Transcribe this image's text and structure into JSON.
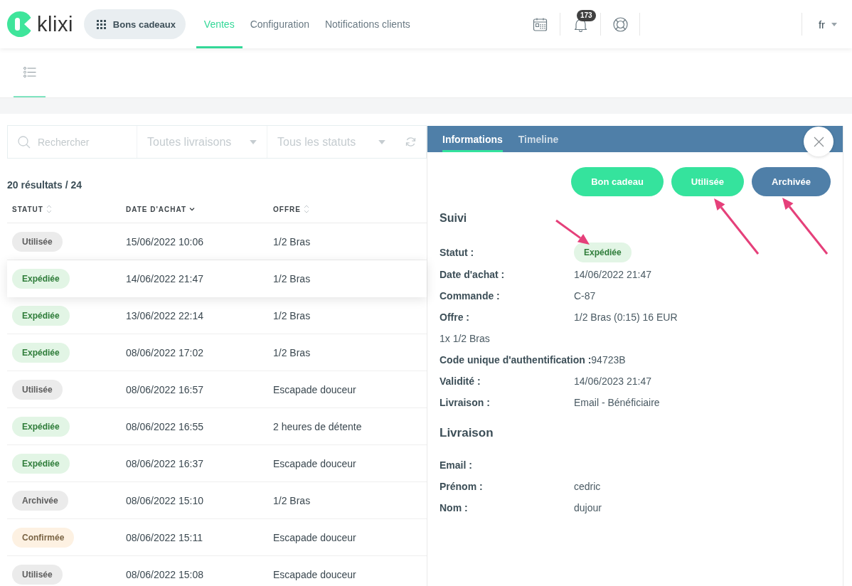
{
  "navbar": {
    "logo": "klixi",
    "app_button": "Bons cadeaux",
    "tabs": [
      {
        "label": "Ventes",
        "selected": true
      },
      {
        "label": "Configuration",
        "selected": false
      },
      {
        "label": "Notifications clients",
        "selected": false
      }
    ],
    "notifications_count": "173",
    "language": "fr"
  },
  "toolbar": {
    "views": [
      {
        "selected": true
      }
    ]
  },
  "filters": {
    "search": {
      "placeholder": "Rechercher"
    },
    "selects": [
      {
        "placeholder": "Toutes livraisons"
      },
      {
        "placeholder": "Tous les statuts"
      }
    ]
  },
  "results": "20 résultats / 24",
  "table": {
    "columns": [
      {
        "label": "STATUT",
        "sorted": false
      },
      {
        "label": "DATE D'ACHAT",
        "sorted": true
      },
      {
        "label": "OFFRE",
        "sorted": false
      }
    ],
    "rows": [
      {
        "status": {
          "label": "Utilisée",
          "kind": "neutral"
        },
        "date": "15/06/2022 10:06",
        "offer": "1/2 Bras",
        "selected": false
      },
      {
        "status": {
          "label": "Expédiée",
          "kind": "success"
        },
        "date": "14/06/2022 21:47",
        "offer": "1/2 Bras",
        "selected": true
      },
      {
        "status": {
          "label": "Expédiée",
          "kind": "success"
        },
        "date": "13/06/2022 22:14",
        "offer": "1/2 Bras",
        "selected": false
      },
      {
        "status": {
          "label": "Expédiée",
          "kind": "success"
        },
        "date": "08/06/2022 17:02",
        "offer": "1/2 Bras",
        "selected": false
      },
      {
        "status": {
          "label": "Utilisée",
          "kind": "neutral"
        },
        "date": "08/06/2022 16:57",
        "offer": "Escapade douceur",
        "selected": false
      },
      {
        "status": {
          "label": "Expédiée",
          "kind": "success"
        },
        "date": "08/06/2022 16:55",
        "offer": "2 heures de détente",
        "selected": false
      },
      {
        "status": {
          "label": "Expédiée",
          "kind": "success"
        },
        "date": "08/06/2022 16:37",
        "offer": "Escapade douceur",
        "selected": false
      },
      {
        "status": {
          "label": "Archivée",
          "kind": "neutral"
        },
        "date": "08/06/2022 15:10",
        "offer": "1/2 Bras",
        "selected": false
      },
      {
        "status": {
          "label": "Confirmée",
          "kind": "warning"
        },
        "date": "08/06/2022 15:11",
        "offer": "Escapade douceur",
        "selected": false
      },
      {
        "status": {
          "label": "Utilisée",
          "kind": "neutral"
        },
        "date": "08/06/2022 15:08",
        "offer": "Escapade douceur",
        "selected": false
      }
    ]
  },
  "detail": {
    "tabs": [
      {
        "label": "Informations",
        "selected": true
      },
      {
        "label": "Timeline",
        "selected": false
      }
    ],
    "actions": [
      {
        "label": "Bon cadeau",
        "kind": "primary"
      },
      {
        "label": "Utilisée",
        "kind": "primary"
      },
      {
        "label": "Archivée",
        "kind": "secondary"
      }
    ],
    "sections": [
      {
        "title": "Suivi",
        "fields": [
          {
            "kind": "badge",
            "label": "Statut :",
            "badge": {
              "label": "Expédiée",
              "kind": "success"
            }
          },
          {
            "kind": "pair",
            "label": "Date d'achat :",
            "value": "14/06/2022 21:47"
          },
          {
            "kind": "pair",
            "label": "Commande :",
            "value": "C-87"
          },
          {
            "kind": "pair",
            "label": "Offre :",
            "value": "1/2 Bras (0:15) 16 EUR"
          },
          {
            "kind": "note",
            "text": "1x 1/2 Bras"
          },
          {
            "kind": "inline",
            "label": "Code unique d'authentification :",
            "value": "94723B"
          },
          {
            "kind": "pair",
            "label": "Validité :",
            "value": "14/06/2023 21:47"
          },
          {
            "kind": "pair",
            "label": "Livraison :",
            "value": "Email - Bénéficiaire"
          }
        ]
      },
      {
        "title": "Livraison",
        "fields": [
          {
            "kind": "pair",
            "label": "Email :"
          },
          {
            "kind": "pair",
            "label": "Prénom :",
            "value": "cedric"
          },
          {
            "kind": "pair",
            "label": "Nom :",
            "value": "dujour"
          }
        ]
      }
    ]
  }
}
